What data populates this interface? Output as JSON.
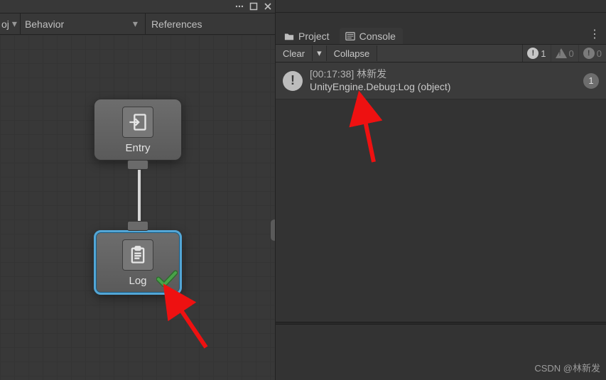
{
  "graph": {
    "title": "ehavior",
    "breadcrumbs": {
      "b0": "oj",
      "b1": "Behavior",
      "b2": "References"
    },
    "nodes": {
      "entry": "Entry",
      "log": "Log"
    }
  },
  "tabs": {
    "project": "Project",
    "console": "Console"
  },
  "toolbar": {
    "clear": "Clear",
    "collapse": "Collapse"
  },
  "counters": {
    "info": "1",
    "warn": "0",
    "error": "0"
  },
  "log_row": {
    "time": "[00:17:38]",
    "name": "林新发",
    "line2": "UnityEngine.Debug:Log (object)",
    "badge": "1"
  },
  "watermark": "CSDN @林新发"
}
